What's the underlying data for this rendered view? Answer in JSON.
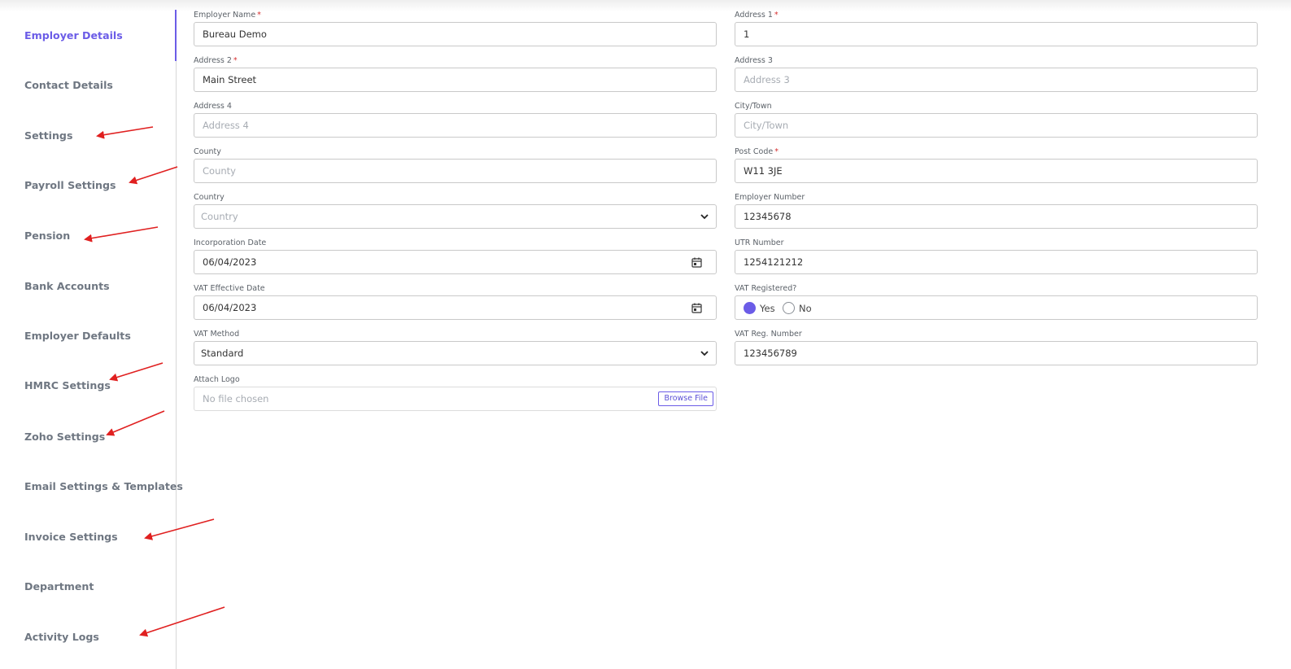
{
  "sidebar": {
    "items": [
      {
        "label": "Employer Details"
      },
      {
        "label": "Contact Details"
      },
      {
        "label": "Settings"
      },
      {
        "label": "Payroll Settings"
      },
      {
        "label": "Pension"
      },
      {
        "label": "Bank Accounts"
      },
      {
        "label": "Employer Defaults"
      },
      {
        "label": "HMRC Settings"
      },
      {
        "label": "Zoho Settings"
      },
      {
        "label": "Email Settings & Templates"
      },
      {
        "label": "Invoice Settings"
      },
      {
        "label": "Department"
      },
      {
        "label": "Activity Logs"
      }
    ],
    "active_item": "Employer Details"
  },
  "form": {
    "employer_name": {
      "label": "Employer Name",
      "required_mark": "*",
      "value": "Bureau Demo"
    },
    "address1": {
      "label": "Address 1",
      "required_mark": "*",
      "value": "1"
    },
    "address2": {
      "label": "Address 2",
      "required_mark": "*",
      "value": "Main Street"
    },
    "address3": {
      "label": "Address 3",
      "placeholder": "Address 3"
    },
    "address4": {
      "label": "Address 4",
      "placeholder": "Address 4"
    },
    "city": {
      "label": "City/Town",
      "placeholder": "City/Town"
    },
    "county": {
      "label": "County",
      "placeholder": "County"
    },
    "post_code": {
      "label": "Post Code",
      "required_mark": "*",
      "value": "W11 3JE"
    },
    "country": {
      "label": "Country",
      "placeholder": "Country"
    },
    "employer_number": {
      "label": "Employer Number",
      "value": "12345678"
    },
    "incorporation_date": {
      "label": "Incorporation Date",
      "value": "06/04/2023"
    },
    "utr_number": {
      "label": "UTR Number",
      "value": "1254121212"
    },
    "vat_effective_date": {
      "label": "VAT Effective Date",
      "value": "06/04/2023"
    },
    "vat_registered": {
      "label": "VAT Registered?",
      "options": [
        "Yes",
        "No"
      ],
      "selected": "Yes"
    },
    "vat_method": {
      "label": "VAT Method",
      "value": "Standard"
    },
    "vat_reg_number": {
      "label": "VAT Reg. Number",
      "value": "123456789"
    },
    "attach_logo": {
      "label": "Attach Logo",
      "placeholder": "No file chosen",
      "button_label": "Browse File"
    }
  },
  "colors": {
    "accent": "#6b5ce7",
    "required": "#d63031",
    "annotation_arrow": "#e02020"
  },
  "icons": {
    "dropdown": "chevron-down-icon",
    "date": "calendar-icon"
  }
}
